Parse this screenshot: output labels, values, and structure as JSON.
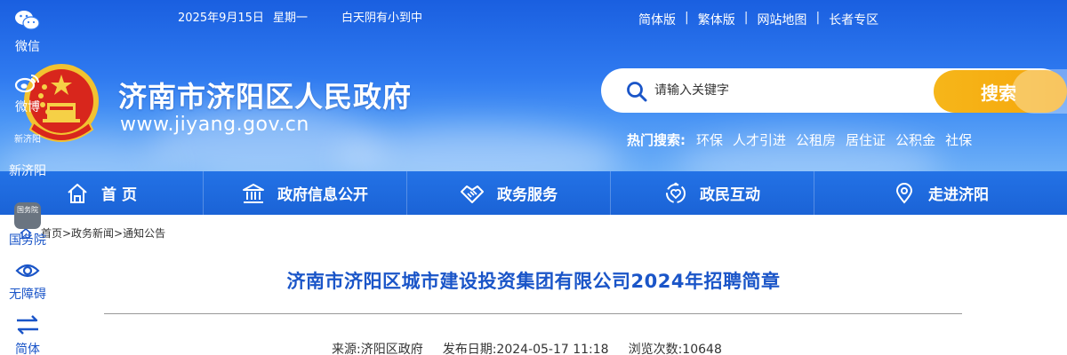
{
  "topbar": {
    "date": "2025年9月15日",
    "weekday": "星期一",
    "weather": "白天阴有小到中",
    "links": [
      "简体版",
      "繁体版",
      "网站地图",
      "长者专区"
    ],
    "separator": "|"
  },
  "site": {
    "title": "济南市济阳区人民政府",
    "url": "www.jiyang.gov.cn"
  },
  "search": {
    "placeholder": "请输入关键字",
    "button_label": "搜索",
    "hot_label": "热门搜索:",
    "hot_keywords": [
      "环保",
      "人才引进",
      "公租房",
      "居住证",
      "公积金",
      "社保"
    ]
  },
  "nav": {
    "items": [
      {
        "label": "首 页",
        "icon": "home-icon"
      },
      {
        "label": "政府信息公开",
        "icon": "building-icon"
      },
      {
        "label": "政务服务",
        "icon": "handshake-icon"
      },
      {
        "label": "政民互动",
        "icon": "people-heart-icon"
      },
      {
        "label": "走进济阳",
        "icon": "location-icon"
      }
    ]
  },
  "breadcrumb": {
    "text": "首页>政务新闻>通知公告"
  },
  "article": {
    "title": "济南市济阳区城市建设投资集团有限公司2024年招聘简章",
    "source": "来源:济阳区政府",
    "publish_date": "发布日期:2024-05-17 11:18",
    "views": "浏览次数:10648"
  },
  "sidebar": {
    "items": [
      {
        "label": "微信",
        "icon": "wechat-icon"
      },
      {
        "label": "微博",
        "icon": "weibo-icon"
      },
      {
        "label": "新济阳",
        "icon": "xinjiyang-logo-icon",
        "logo_text": "新济阳"
      },
      {
        "label": "国务院",
        "icon": "state-council-icon",
        "logo_text": "国务院"
      },
      {
        "label": "无障碍",
        "icon": "eye-icon"
      },
      {
        "label": "简体",
        "icon": "swap-arrows-icon"
      }
    ]
  },
  "colors": {
    "header_blue": "#2f7af0",
    "nav_blue": "#1b63d6",
    "search_orange": "#f5a60a",
    "title_blue": "#1a55c8"
  }
}
